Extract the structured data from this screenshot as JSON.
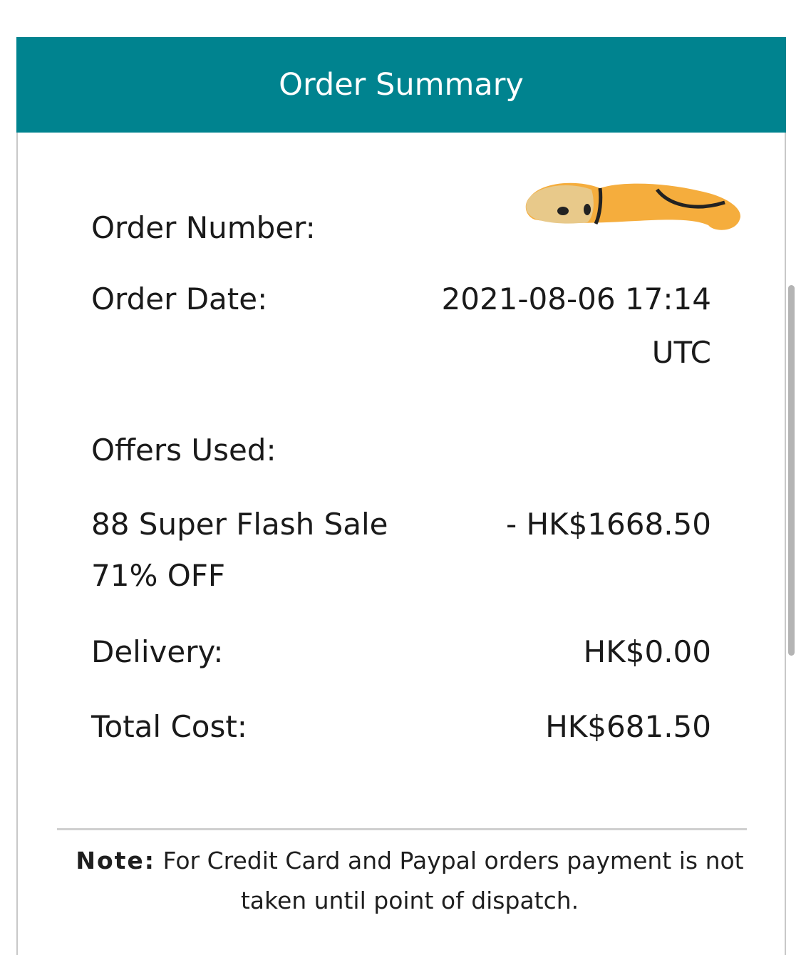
{
  "header": {
    "title": "Order Summary"
  },
  "order_number": {
    "label": "Order Number:",
    "value_redacted": true
  },
  "order_date": {
    "label": "Order Date:",
    "value_line1": "2021-08-06 17:14",
    "value_line2": "UTC"
  },
  "offers": {
    "label": "Offers Used:",
    "items": [
      {
        "name_line1": "88 Super Flash Sale",
        "name_line2": "71% OFF",
        "amount": "- HK$1668.50"
      }
    ]
  },
  "delivery": {
    "label": "Delivery:",
    "value": "HK$0.00"
  },
  "total": {
    "label": "Total Cost:",
    "value": "HK$681.50"
  },
  "note": {
    "label": "Note:",
    "text": "For Credit Card and Paypal orders payment is not taken until point of dispatch."
  },
  "colors": {
    "header_bg": "#00838f",
    "header_text": "#ffffff",
    "redaction": "#f5ad3d"
  }
}
